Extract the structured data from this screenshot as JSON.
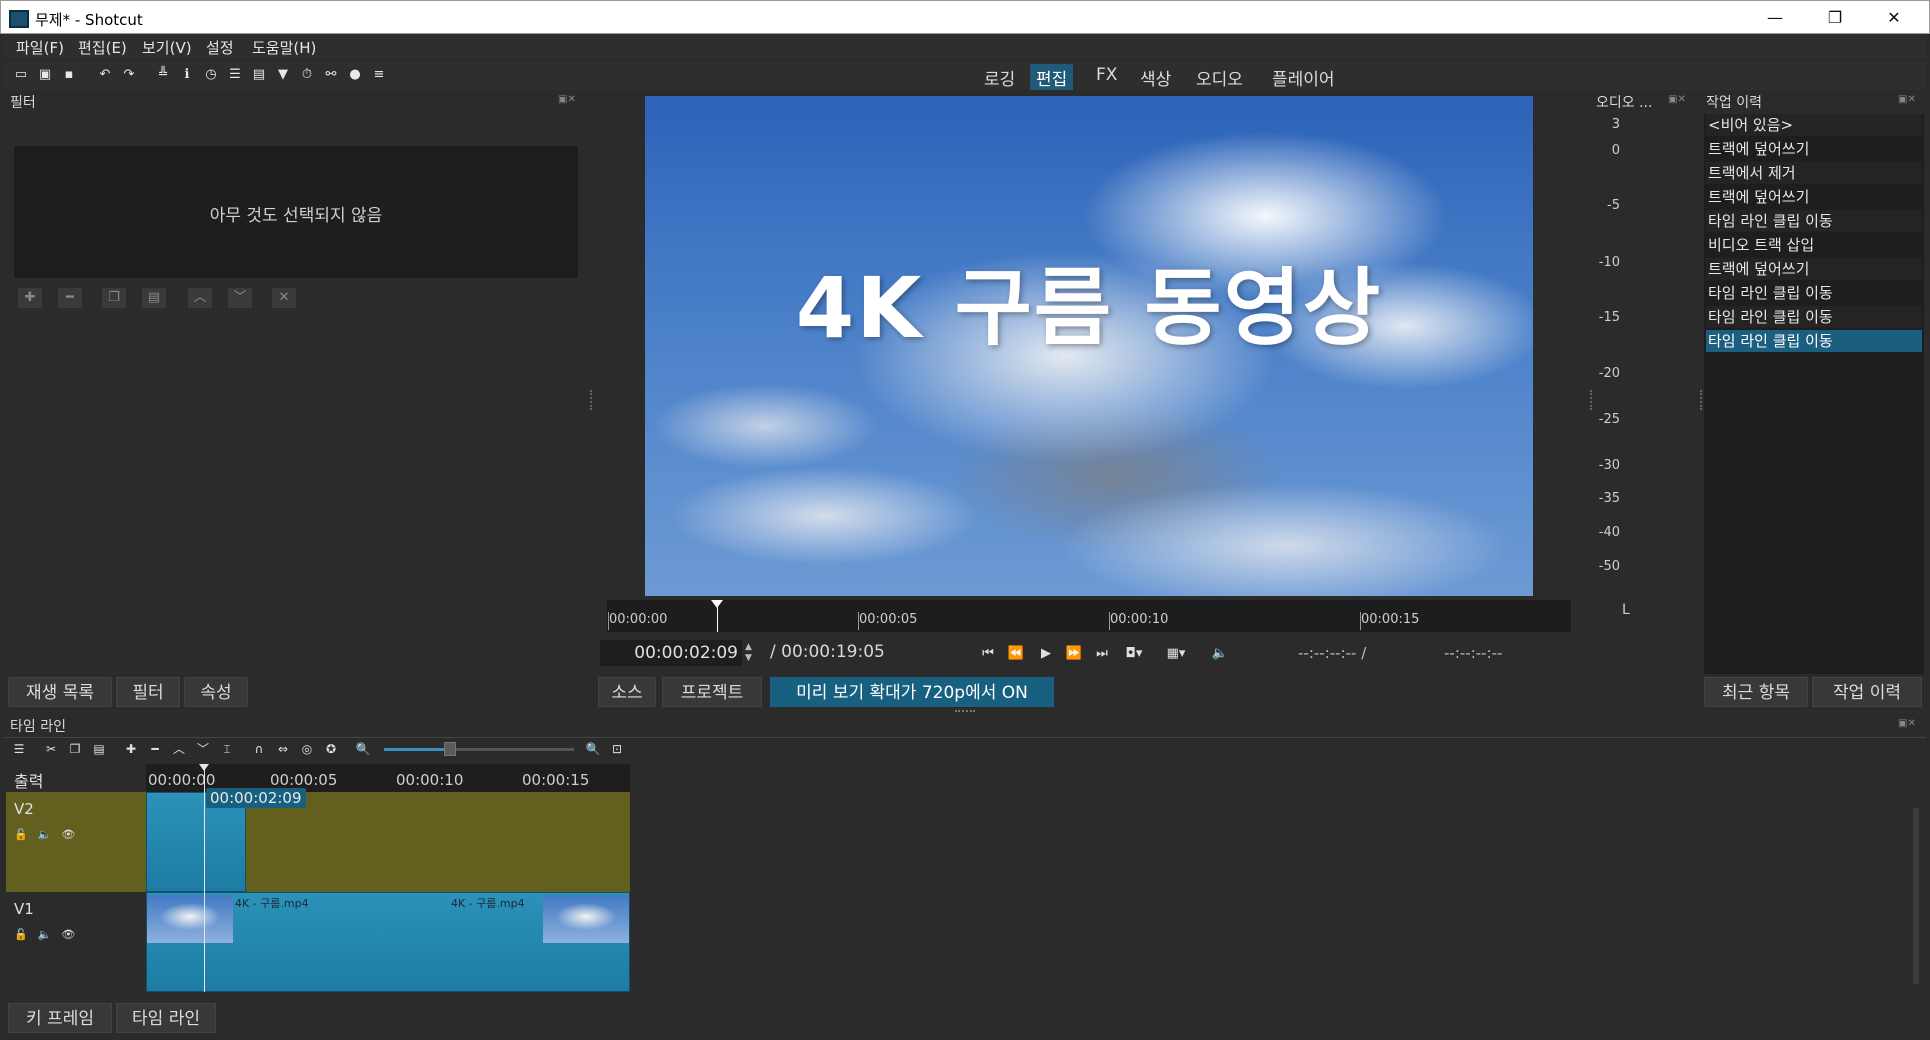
{
  "window": {
    "title": "무제* - Shotcut",
    "minimize": "—",
    "restore": "❐",
    "close": "✕"
  },
  "menu": [
    "파일(F)",
    "편집(E)",
    "보기(V)",
    "설정",
    "도움말(H)"
  ],
  "layouts": {
    "logging": "로깅",
    "editing": "편집",
    "fx": "FX",
    "color": "색상",
    "audio": "오디오",
    "player": "플레이어"
  },
  "filters": {
    "title": "필터",
    "empty_text": "아무 것도 선택되지 않음"
  },
  "video": {
    "overlay_text": "4K 구름 동영상"
  },
  "player": {
    "ruler_labels": [
      "00:00:00",
      "00:00:05",
      "00:00:10",
      "00:00:15"
    ],
    "current_time": "00:00:02:09",
    "duration": "/ 00:00:19:05",
    "in_point": "--:--:--:-- /",
    "out_point": "--:--:--:--"
  },
  "audio_meter": {
    "title": "오디오 ...",
    "levels": [
      "3",
      "0",
      "-5",
      "-10",
      "-15",
      "-20",
      "-25",
      "-30",
      "-35",
      "-40",
      "-50"
    ],
    "channel": "L"
  },
  "history": {
    "title": "작업 이력",
    "items": [
      "<비어 있음>",
      "트랙에 덮어쓰기",
      "트랙에서 제거",
      "트랙에 덮어쓰기",
      "타임 라인 클립 이동",
      "비디오 트랙 삽입",
      "트랙에 덮어쓰기",
      "타임 라인 클립 이동",
      "타임 라인 클립 이동",
      "타임 라인 클립 이동"
    ]
  },
  "left_tabs": [
    "재생 목록",
    "필터",
    "속성"
  ],
  "center_tabs": [
    "소스",
    "프로젝트"
  ],
  "preview_scaling": "미리 보기 확대가 720p에서 ON",
  "right_tabs": [
    "최근 항목",
    "작업 이력"
  ],
  "timeline": {
    "title": "타임 라인",
    "output_label": "출력",
    "ruler_labels": [
      "00:00:00",
      "00:00:05",
      "00:00:10",
      "00:00:15"
    ],
    "playhead_time": "00:00:02:09",
    "tracks": [
      {
        "name": "V2"
      },
      {
        "name": "V1"
      }
    ],
    "clips": {
      "v1_a": "4K - 구름.mp4",
      "v1_b": "4K - 구름.mp4"
    }
  },
  "bottom_tabs": [
    "키 프레임",
    "타임 라인"
  ]
}
